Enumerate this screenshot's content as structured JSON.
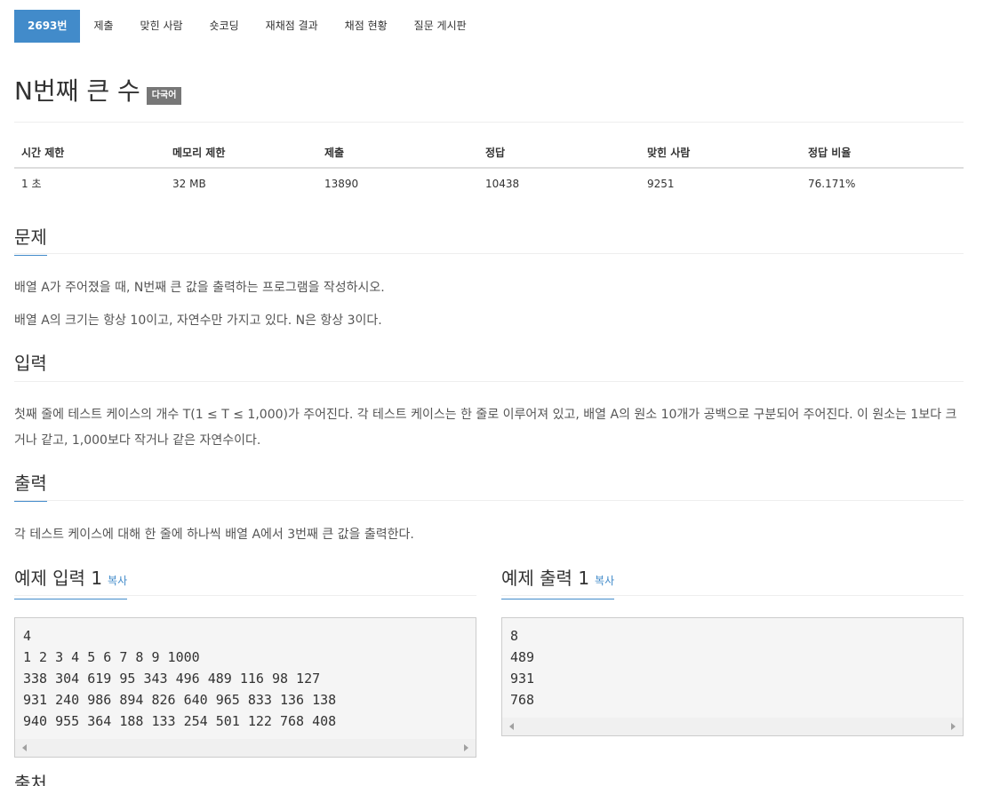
{
  "tabs": [
    {
      "label": "2693번",
      "active": true
    },
    {
      "label": "제출"
    },
    {
      "label": "맞힌 사람"
    },
    {
      "label": "숏코딩"
    },
    {
      "label": "재채점 결과"
    },
    {
      "label": "채점 현황"
    },
    {
      "label": "질문 게시판"
    }
  ],
  "problem": {
    "title": "N번째 큰 수",
    "badge": "다국어"
  },
  "info_table": {
    "headers": [
      "시간 제한",
      "메모리 제한",
      "제출",
      "정답",
      "맞힌 사람",
      "정답 비율"
    ],
    "values": [
      "1 초",
      "32 MB",
      "13890",
      "10438",
      "9251",
      "76.171%"
    ]
  },
  "sections": {
    "description": {
      "title": "문제",
      "paragraphs": [
        "배열 A가 주어졌을 때, N번째 큰 값을 출력하는 프로그램을 작성하시오.",
        "배열 A의 크기는 항상 10이고, 자연수만 가지고 있다. N은 항상 3이다."
      ]
    },
    "input": {
      "title": "입력",
      "text": "첫째 줄에 테스트 케이스의 개수 T(1 ≤ T ≤ 1,000)가 주어진다. 각 테스트 케이스는 한 줄로 이루어져 있고, 배열 A의 원소 10개가 공백으로 구분되어 주어진다. 이 원소는 1보다 크거나 같고, 1,000보다 작거나 같은 자연수이다."
    },
    "output": {
      "title": "출력",
      "text": "각 테스트 케이스에 대해 한 줄에 하나씩 배열 A에서 3번째 큰 값을 출력한다."
    }
  },
  "sample_input": {
    "title": "예제 입력 1",
    "copy_label": "복사",
    "lines": [
      "4",
      "1 2 3 4 5 6 7 8 9 1000",
      "338 304 619 95 343 496 489 116 98 127",
      "931 240 986 894 826 640 965 833 136 138",
      "940 955 364 188 133 254 501 122 768 408"
    ]
  },
  "sample_output": {
    "title": "예제 출력 1",
    "copy_label": "복사",
    "lines": [
      "8",
      "489",
      "931",
      "768"
    ]
  },
  "source": {
    "title": "출처"
  },
  "colors": {
    "accent": "#428bca",
    "badge": "#777777",
    "pre_bg": "#f5f5f5"
  }
}
